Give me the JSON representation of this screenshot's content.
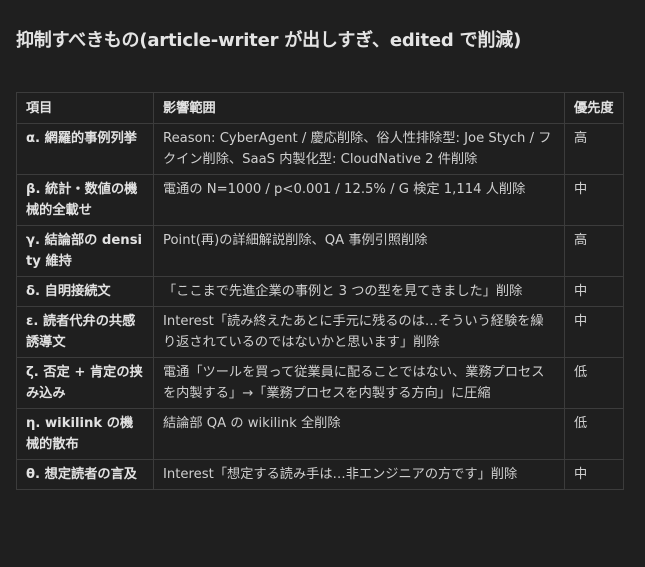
{
  "title": "抑制すべきもの(article-writer が出しすぎ、edited で削減)",
  "table": {
    "headers": {
      "item": "項目",
      "scope": "影響範囲",
      "priority": "優先度"
    },
    "rows": [
      {
        "item": "α. 網羅的事例列挙",
        "scope": "Reason: CyberAgent / 慶応削除、俗人性排除型: Joe Stych / フクイン削除、SaaS 内製化型: CloudNative 2 件削除",
        "priority": "高"
      },
      {
        "item": "β. 統計・数値の機械的全載せ",
        "scope": "電通の N=1000 / p<0.001 / 12.5% / G 検定 1,114 人削除",
        "priority": "中"
      },
      {
        "item": "γ. 結論部の density 維持",
        "scope": "Point(再)の詳細解説削除、QA 事例引照削除",
        "priority": "高"
      },
      {
        "item": "δ. 自明接続文",
        "scope": "「ここまで先進企業の事例と 3 つの型を見てきました」削除",
        "priority": "中"
      },
      {
        "item": "ε. 読者代弁の共感誘導文",
        "scope": "Interest「読み終えたあとに手元に残るのは…そういう経験を繰り返されているのではないかと思います」削除",
        "priority": "中"
      },
      {
        "item": "ζ. 否定 + 肯定の挟み込み",
        "scope": "電通「ツールを買って従業員に配ることではない、業務プロセスを内製する」→「業務プロセスを内製する方向」に圧縮",
        "priority": "低"
      },
      {
        "item": "η. wikilink の機械的散布",
        "scope": "結論部 QA の wikilink 全削除",
        "priority": "低"
      },
      {
        "item": "θ. 想定読者の言及",
        "scope": "Interest「想定する読み手は…非エンジニアの方です」削除",
        "priority": "中"
      }
    ]
  }
}
